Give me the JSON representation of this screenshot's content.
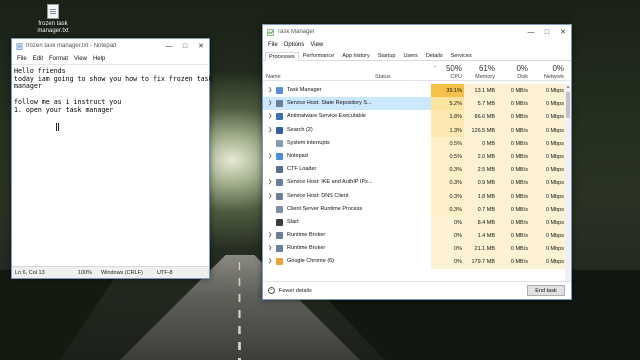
{
  "desktop": {
    "icon_label": "frozen task manager.txt"
  },
  "notepad": {
    "title": "frozen task manager.txt - Notepad",
    "menu": [
      "File",
      "Edit",
      "Format",
      "View",
      "Help"
    ],
    "content": "Hello friends\ntoday iam going to show you how to fix frozen task\nmanager\n\nfollow me as i instruct you\n1. open your task manager",
    "status": {
      "position": "Ln 6, Col 13",
      "zoom": "100%",
      "line_endings": "Windows (CRLF)",
      "encoding": "UTF-8"
    }
  },
  "task_manager": {
    "title": "Task Manager",
    "menu": [
      "File",
      "Options",
      "View"
    ],
    "tabs": [
      "Processes",
      "Performance",
      "App history",
      "Startup",
      "Users",
      "Details",
      "Services"
    ],
    "active_tab": "Processes",
    "columns": {
      "name": "Name",
      "status": "Status",
      "cpu_pct": "50%",
      "cpu": "CPU",
      "mem_pct": "61%",
      "mem": "Memory",
      "disk_pct": "0%",
      "disk": "Disk",
      "net_pct": "0%",
      "net": "Network"
    },
    "rows": [
      {
        "name": "Task Manager",
        "status": "",
        "cpu": "39.1%",
        "mem": "13.1 MB",
        "disk": "0 MB/s",
        "net": "0 Mbps",
        "expandable": true,
        "icon_color": "#5b8fd4",
        "cpu_heat": "#f7c04a"
      },
      {
        "name": "Service Host: State Repository S...",
        "status": "",
        "cpu": "5.2%",
        "mem": "5.7 MB",
        "disk": "0 MB/s",
        "net": "0 Mbps",
        "expandable": true,
        "icon_color": "#6a7f9b",
        "cpu_heat": "#fbe3a0",
        "selected": true
      },
      {
        "name": "Antimalware Service Executable",
        "status": "",
        "cpu": "1.8%",
        "mem": "86.6 MB",
        "disk": "0 MB/s",
        "net": "0 Mbps",
        "expandable": true,
        "icon_color": "#3d6fb3",
        "cpu_heat": "#fce8b2"
      },
      {
        "name": "Search (2)",
        "status": "pin",
        "cpu": "1.3%",
        "mem": "126.5 MB",
        "disk": "0 MB/s",
        "net": "0 Mbps",
        "expandable": true,
        "icon_color": "#2f5f9e",
        "cpu_heat": "#fce8b2"
      },
      {
        "name": "System interrupts",
        "status": "",
        "cpu": "0.5%",
        "mem": "0 MB",
        "disk": "0 MB/s",
        "net": "0 Mbps",
        "expandable": false,
        "icon_color": "#8a9bb0",
        "cpu_heat": "#fdf0c9"
      },
      {
        "name": "Notepad",
        "status": "",
        "cpu": "0.5%",
        "mem": "2.0 MB",
        "disk": "0 MB/s",
        "net": "0 Mbps",
        "expandable": true,
        "icon_color": "#4a90d9",
        "cpu_heat": "#fdf0c9"
      },
      {
        "name": "CTF Loader",
        "status": "",
        "cpu": "0.3%",
        "mem": "2.5 MB",
        "disk": "0 MB/s",
        "net": "0 Mbps",
        "expandable": false,
        "icon_color": "#5a6e8a",
        "cpu_heat": "#fdf0c9"
      },
      {
        "name": "Service Host: IKE and AuthIP IPs...",
        "status": "",
        "cpu": "0.3%",
        "mem": "0.9 MB",
        "disk": "0 MB/s",
        "net": "0 Mbps",
        "expandable": true,
        "icon_color": "#6a7f9b",
        "cpu_heat": "#fdf0c9"
      },
      {
        "name": "Service Host: DNS Client",
        "status": "",
        "cpu": "0.3%",
        "mem": "1.8 MB",
        "disk": "0 MB/s",
        "net": "0 Mbps",
        "expandable": true,
        "icon_color": "#6a7f9b",
        "cpu_heat": "#fdf0c9"
      },
      {
        "name": "Client Server Runtime Process",
        "status": "",
        "cpu": "0.3%",
        "mem": "0.7 MB",
        "disk": "0 MB/s",
        "net": "0 Mbps",
        "expandable": false,
        "icon_color": "#7d8da3",
        "cpu_heat": "#fdf0c9"
      },
      {
        "name": "Start",
        "status": "",
        "cpu": "0%",
        "mem": "8.4 MB",
        "disk": "0 MB/s",
        "net": "0 Mbps",
        "expandable": false,
        "icon_color": "#3b3b3b",
        "cpu_heat": "#fdf3d4"
      },
      {
        "name": "Runtime Broker",
        "status": "",
        "cpu": "0%",
        "mem": "1.4 MB",
        "disk": "0 MB/s",
        "net": "0 Mbps",
        "expandable": true,
        "icon_color": "#6a7f9b",
        "cpu_heat": "#fdf3d4"
      },
      {
        "name": "Runtime Broker",
        "status": "",
        "cpu": "0%",
        "mem": "21.1 MB",
        "disk": "0 MB/s",
        "net": "0 Mbps",
        "expandable": true,
        "icon_color": "#6a7f9b",
        "cpu_heat": "#fdf3d4"
      },
      {
        "name": "Google Chrome (6)",
        "status": "",
        "cpu": "0%",
        "mem": "179.7 MB",
        "disk": "0 MB/s",
        "net": "0 Mbps",
        "expandable": true,
        "icon_color": "#e8a33d",
        "cpu_heat": "#fdf3d4"
      }
    ],
    "fewer_details_label": "Fewer details",
    "end_task_label": "End task"
  }
}
